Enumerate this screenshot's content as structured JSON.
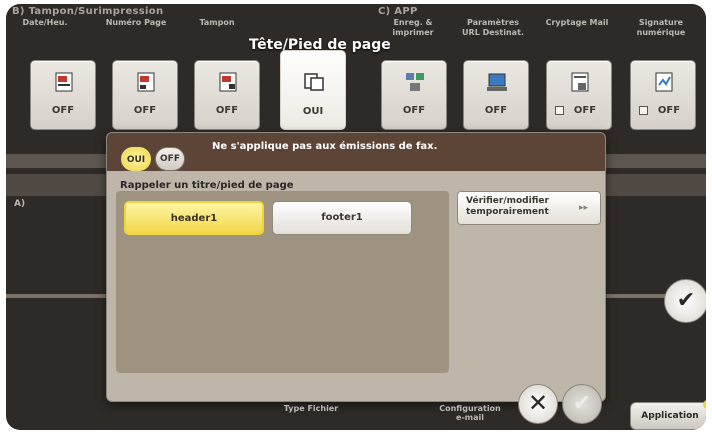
{
  "sections": {
    "b_title": "B) Tampon/Surimpression",
    "c_title": "C) APP"
  },
  "columns": [
    {
      "label": "Date/Heu."
    },
    {
      "label": "Numéro Page"
    },
    {
      "label": "Tampon"
    },
    {
      "label": ""
    },
    {
      "label": "Enreg. & imprimer"
    },
    {
      "label": "Paramètres URL Destinat."
    },
    {
      "label": "Cryptage Mail"
    },
    {
      "label": "Signature numérique"
    }
  ],
  "heading": "Tête/Pied de page",
  "tiles": [
    {
      "value": "OFF",
      "icon": "stamp-date-icon"
    },
    {
      "value": "OFF",
      "icon": "page-number-icon"
    },
    {
      "value": "OFF",
      "icon": "stamp-icon"
    },
    {
      "value": "OUI",
      "icon": "header-footer-icon"
    },
    {
      "value": "OFF",
      "icon": "save-print-icon"
    },
    {
      "value": "OFF",
      "icon": "url-destination-icon"
    },
    {
      "value": "OFF",
      "icon": "mail-encryption-icon"
    },
    {
      "value": "OFF",
      "icon": "digital-signature-icon"
    }
  ],
  "dialog": {
    "oui_label": "OUI",
    "off_label": "OFF",
    "note": "Ne s'applique pas aux émissions de fax.",
    "recall_label": "Rappeler un titre/pied de page",
    "header_button": "header1",
    "footer_button": "footer1",
    "verify_button": "Vérifier/modifier temporairement"
  },
  "left_marker": "A)",
  "bottom": {
    "file_type": "Type Fichier",
    "email_config": "Configuration e-mail",
    "application": "Application"
  },
  "colors": {
    "selected": "#f1d64a",
    "dialog_bar": "#5c4536",
    "background": "#2e2a27"
  }
}
